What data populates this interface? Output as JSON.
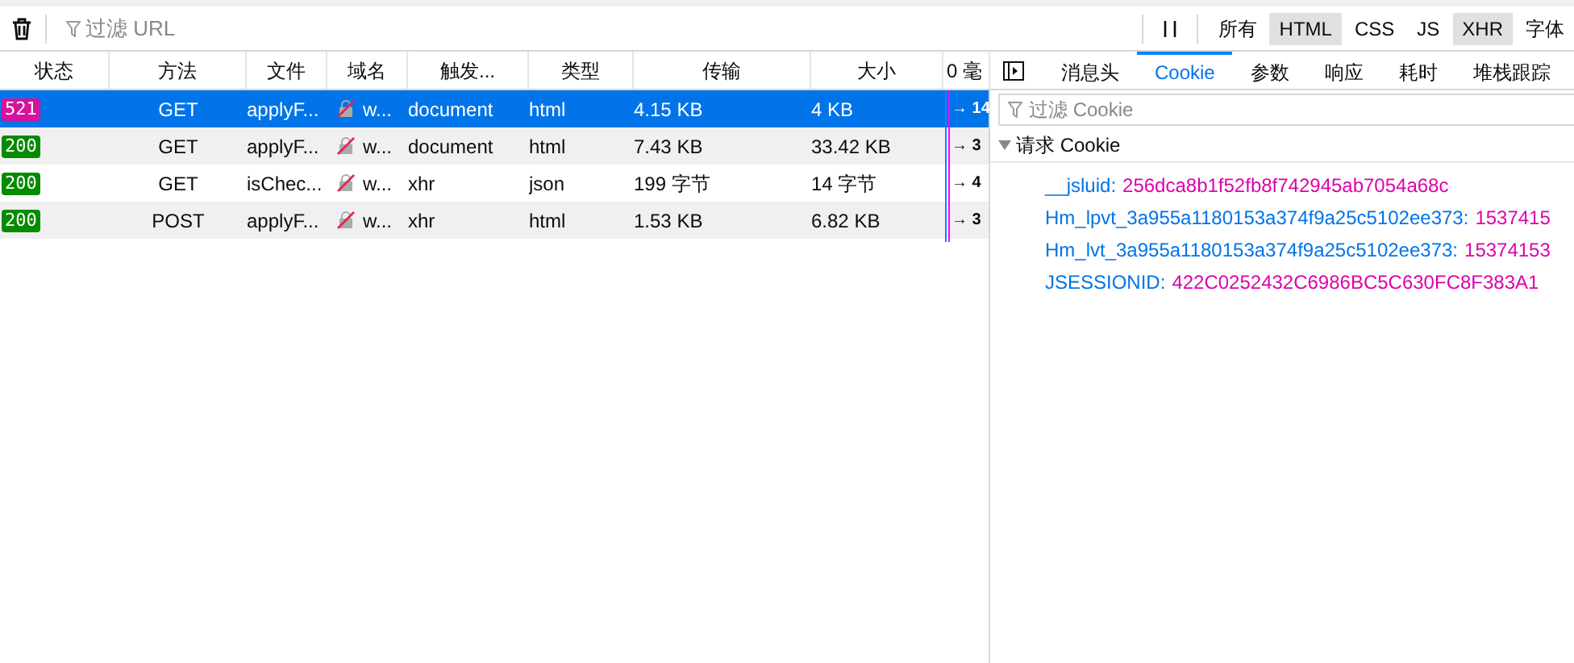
{
  "toolbar": {
    "filter_placeholder": "过滤 URL",
    "type_filters": [
      {
        "label": "所有",
        "selected": false
      },
      {
        "label": "HTML",
        "selected": true
      },
      {
        "label": "CSS",
        "selected": false
      },
      {
        "label": "JS",
        "selected": false
      },
      {
        "label": "XHR",
        "selected": true
      },
      {
        "label": "字体",
        "selected": false
      }
    ]
  },
  "table": {
    "columns": [
      "状态",
      "方法",
      "文件",
      "域名",
      "触发...",
      "类型",
      "传输",
      "大小",
      "0 毫"
    ],
    "rows": [
      {
        "status": "521",
        "color": "#d5139b",
        "method": "GET",
        "file": "applyF...",
        "domain": "w...",
        "trigger": "document",
        "type": "html",
        "transferred": "4.15 KB",
        "size": "4 KB",
        "timing": "→ 14",
        "selected": true
      },
      {
        "status": "200",
        "color": "#058b00",
        "method": "GET",
        "file": "applyF...",
        "domain": "w...",
        "trigger": "document",
        "type": "html",
        "transferred": "7.43 KB",
        "size": "33.42 KB",
        "timing": "→ 3",
        "selected": false
      },
      {
        "status": "200",
        "color": "#058b00",
        "method": "GET",
        "file": "isChec...",
        "domain": "w...",
        "trigger": "xhr",
        "type": "json",
        "transferred": "199 字节",
        "size": "14 字节",
        "timing": "→ 4",
        "selected": false
      },
      {
        "status": "200",
        "color": "#058b00",
        "method": "POST",
        "file": "applyF...",
        "domain": "w...",
        "trigger": "xhr",
        "type": "html",
        "transferred": "1.53 KB",
        "size": "6.82 KB",
        "timing": "→ 3",
        "selected": false
      }
    ]
  },
  "details": {
    "tabs": [
      {
        "label": "消息头",
        "selected": false
      },
      {
        "label": "Cookie",
        "selected": true
      },
      {
        "label": "参数",
        "selected": false
      },
      {
        "label": "响应",
        "selected": false
      },
      {
        "label": "耗时",
        "selected": false
      },
      {
        "label": "堆栈跟踪",
        "selected": false
      }
    ],
    "filter_placeholder": "过滤 Cookie",
    "section": {
      "title": "请求 Cookie",
      "expanded": true,
      "items": [
        {
          "name": "__jsluid:",
          "value": "256dca8b1f52fb8f742945ab7054a68c"
        },
        {
          "name": "Hm_lpvt_3a955a1180153a374f9a25c5102ee373:",
          "value": "1537415"
        },
        {
          "name": "Hm_lvt_3a955a1180153a374f9a25c5102ee373:",
          "value": "15374153"
        },
        {
          "name": "JSESSIONID:",
          "value": "422C0252432C6986BC5C630FC8F383A1"
        }
      ]
    }
  }
}
